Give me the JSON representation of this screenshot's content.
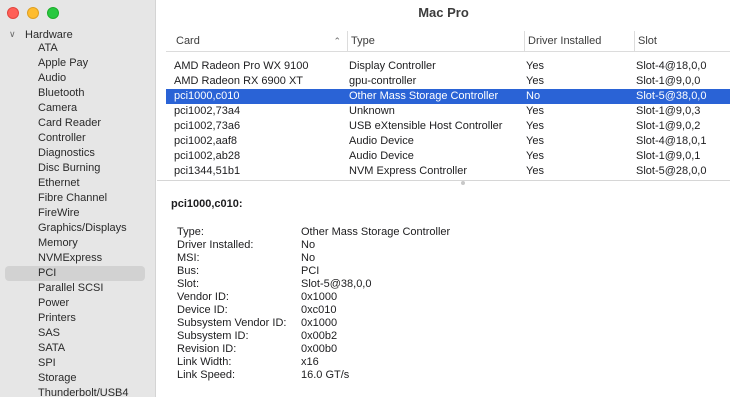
{
  "window": {
    "title": "Mac Pro"
  },
  "colors": {
    "selection": "#2a63d6",
    "sidebar_bg": "#e6e6e6",
    "sidebar_selected": "#d2d2d2"
  },
  "sidebar": {
    "group_label": "Hardware",
    "items": [
      {
        "label": "ATA"
      },
      {
        "label": "Apple Pay"
      },
      {
        "label": "Audio"
      },
      {
        "label": "Bluetooth"
      },
      {
        "label": "Camera"
      },
      {
        "label": "Card Reader"
      },
      {
        "label": "Controller"
      },
      {
        "label": "Diagnostics"
      },
      {
        "label": "Disc Burning"
      },
      {
        "label": "Ethernet"
      },
      {
        "label": "Fibre Channel"
      },
      {
        "label": "FireWire"
      },
      {
        "label": "Graphics/Displays"
      },
      {
        "label": "Memory"
      },
      {
        "label": "NVMExpress"
      },
      {
        "label": "PCI",
        "selected": true
      },
      {
        "label": "Parallel SCSI"
      },
      {
        "label": "Power"
      },
      {
        "label": "Printers"
      },
      {
        "label": "SAS"
      },
      {
        "label": "SATA"
      },
      {
        "label": "SPI"
      },
      {
        "label": "Storage"
      },
      {
        "label": "Thunderbolt/USB4"
      }
    ]
  },
  "table": {
    "columns": [
      "Card",
      "Type",
      "Driver Installed",
      "Slot"
    ],
    "sort_column": "Card",
    "sort_direction": "ascending",
    "rows": [
      {
        "card": "AMD Radeon Pro WX 9100",
        "type": "Display Controller",
        "driver": "Yes",
        "slot": "Slot-4@18,0,0"
      },
      {
        "card": "AMD Radeon RX 6900 XT",
        "type": "gpu-controller",
        "driver": "Yes",
        "slot": "Slot-1@9,0,0"
      },
      {
        "card": "pci1000,c010",
        "type": "Other Mass Storage Controller",
        "driver": "No",
        "slot": "Slot-5@38,0,0",
        "selected": true
      },
      {
        "card": "pci1002,73a4",
        "type": "Unknown",
        "driver": "Yes",
        "slot": "Slot-1@9,0,3"
      },
      {
        "card": "pci1002,73a6",
        "type": "USB eXtensible Host Controller",
        "driver": "Yes",
        "slot": "Slot-1@9,0,2"
      },
      {
        "card": "pci1002,aaf8",
        "type": "Audio Device",
        "driver": "Yes",
        "slot": "Slot-4@18,0,1"
      },
      {
        "card": "pci1002,ab28",
        "type": "Audio Device",
        "driver": "Yes",
        "slot": "Slot-1@9,0,1"
      },
      {
        "card": "pci1344,51b1",
        "type": "NVM Express Controller",
        "driver": "Yes",
        "slot": "Slot-5@28,0,0"
      }
    ]
  },
  "detail": {
    "title": "pci1000,c010:",
    "properties": [
      {
        "key": "Type:",
        "value": "Other Mass Storage Controller"
      },
      {
        "key": "Driver Installed:",
        "value": "No"
      },
      {
        "key": "MSI:",
        "value": "No"
      },
      {
        "key": "Bus:",
        "value": "PCI"
      },
      {
        "key": "Slot:",
        "value": "Slot-5@38,0,0"
      },
      {
        "key": "Vendor ID:",
        "value": "0x1000"
      },
      {
        "key": "Device ID:",
        "value": "0xc010"
      },
      {
        "key": "Subsystem Vendor ID:",
        "value": "0x1000"
      },
      {
        "key": "Subsystem ID:",
        "value": "0x00b2"
      },
      {
        "key": "Revision ID:",
        "value": "0x00b0"
      },
      {
        "key": "Link Width:",
        "value": "x16"
      },
      {
        "key": "Link Speed:",
        "value": "16.0 GT/s"
      }
    ]
  }
}
